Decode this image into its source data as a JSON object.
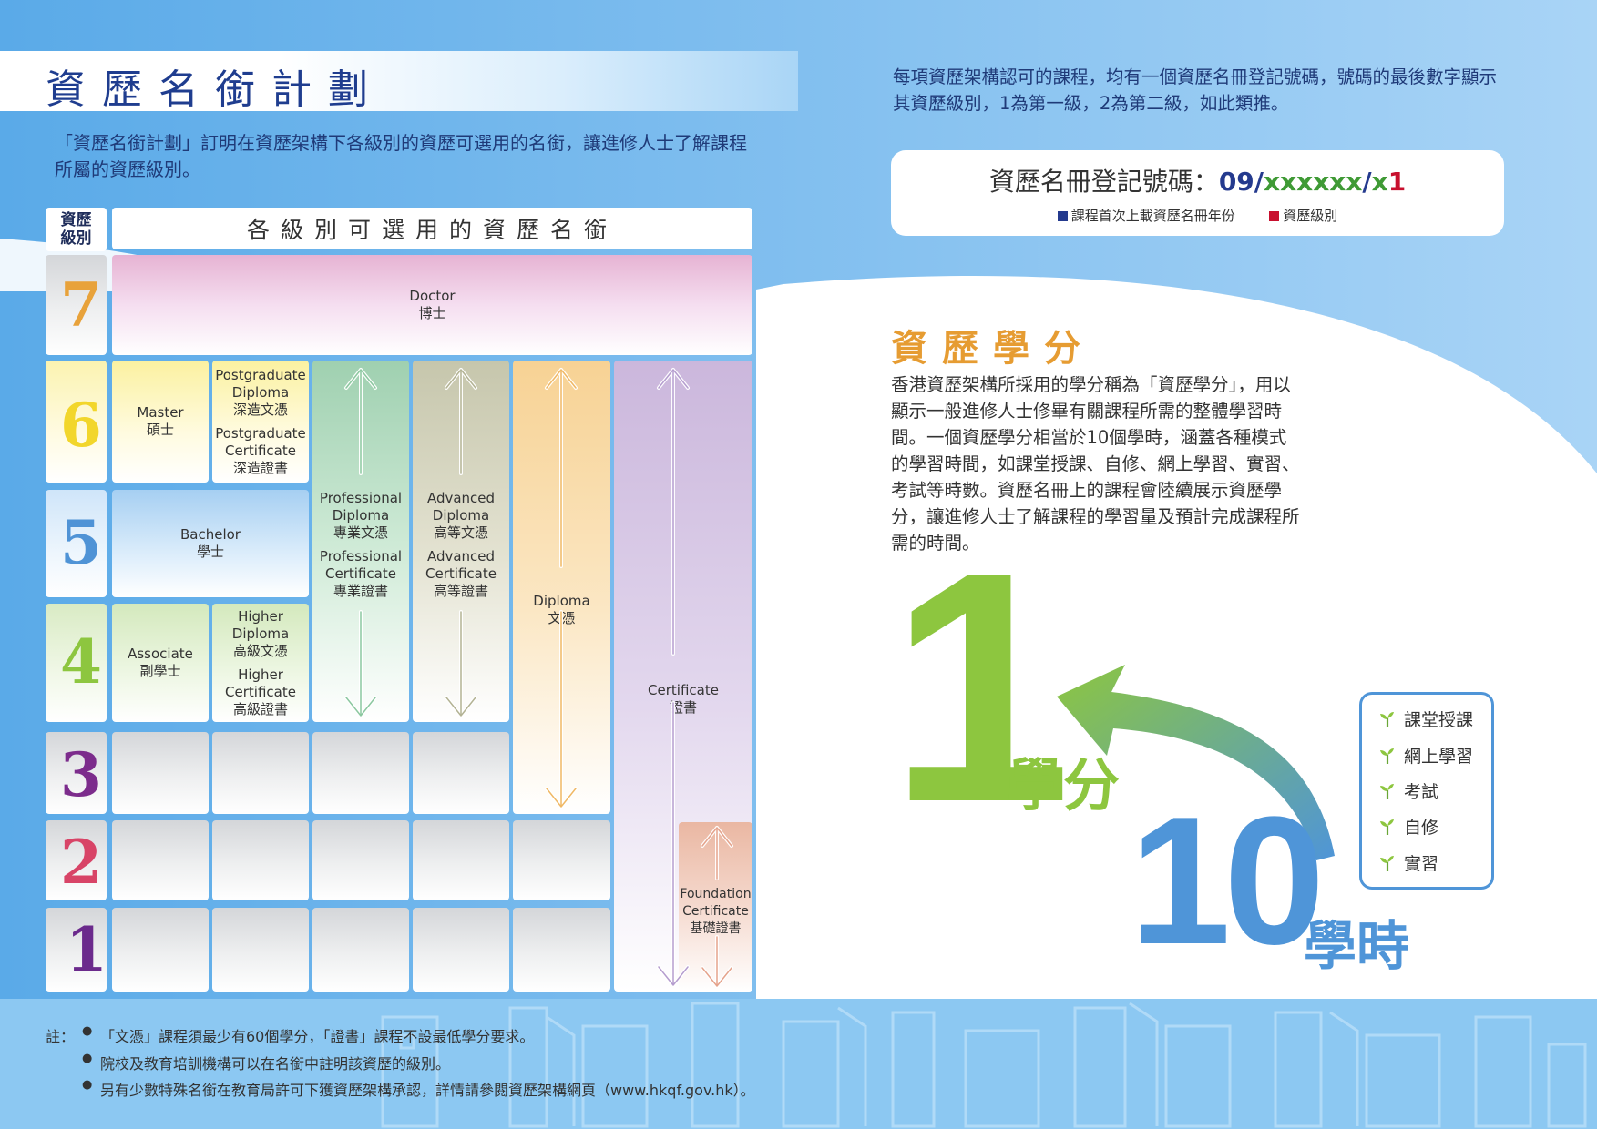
{
  "header": {
    "title": "資歷名銜計劃",
    "intro": "「資歷名銜計劃」訂明在資歷架構下各級別的資歷可選用的名銜，讓進修人士了解課程所屬的資歷級別。"
  },
  "table": {
    "level_header": "資歷級別",
    "titles_header": "各級別可選用的資歷名銜",
    "levels": [
      "7",
      "6",
      "5",
      "4",
      "3",
      "2",
      "1"
    ],
    "level_colors": [
      "#e8a23a",
      "#f2d62b",
      "#4f93d6",
      "#8dc63f",
      "#7c2c8c",
      "#d84467",
      "#6b2a8c"
    ],
    "cells": {
      "doctor": [
        "Doctor",
        "博士"
      ],
      "master": [
        "Master",
        "碩士"
      ],
      "pg_diploma": [
        "Postgraduate",
        "Diploma",
        "深造文憑"
      ],
      "pg_certificate": [
        "Postgraduate",
        "Certificate",
        "深造證書"
      ],
      "bachelor": [
        "Bachelor",
        "學士"
      ],
      "associate": [
        "Associate",
        "副學士"
      ],
      "higher_diploma": [
        "Higher",
        "Diploma",
        "高級文憑"
      ],
      "higher_certificate": [
        "Higher",
        "Certificate",
        "高級證書"
      ],
      "prof_diploma": [
        "Professional",
        "Diploma",
        "專業文憑"
      ],
      "prof_certificate": [
        "Professional",
        "Certificate",
        "專業證書"
      ],
      "adv_diploma": [
        "Advanced",
        "Diploma",
        "高等文憑"
      ],
      "adv_certificate": [
        "Advanced",
        "Certificate",
        "高等證書"
      ],
      "diploma": [
        "Diploma",
        "文憑"
      ],
      "certificate": [
        "Certificate",
        "證書"
      ],
      "foundation_certificate": [
        "Foundation",
        "Certificate",
        "基礎證書"
      ]
    }
  },
  "registration": {
    "intro": "每項資歷架構認可的課程，均有一個資歷名冊登記號碼，號碼的最後數字顯示其資歷級別，1為第一級，2為第二級，如此類推。",
    "label": "資歷名冊登記號碼：",
    "code_year": "09",
    "code_sep1": "/",
    "code_mid": "xxxxxx",
    "code_sep2": "/",
    "code_x": "x",
    "code_level": "1",
    "legend_year": "課程首次上載資歷名冊年份",
    "legend_level": "資歷級別",
    "color_year": "#243a8e",
    "color_level": "#c8102e"
  },
  "credits": {
    "title": "資歷學分",
    "body": "香港資歷架構所採用的學分稱為「資歷學分」，用以顯示一般進修人士修畢有關課程所需的整體學習時間。一個資歷學分相當於10個學時，涵蓋各種模式的學習時間，如課堂授課、自修、網上學習、實習、考試等時數。資歷名冊上的課程會陸續展示資歷學分，讓進修人士了解課程的學習量及預計完成課程所需的時間。",
    "big_one": "1",
    "credit_word": "學分",
    "big_ten": "10",
    "hours_word": "學時",
    "modes": [
      "課堂授課",
      "網上學習",
      "考試",
      "自修",
      "實習"
    ]
  },
  "notes": {
    "label": "註：",
    "bullet": "●",
    "items": [
      "「文憑」課程須最少有60個學分，「證書」課程不設最低學分要求。",
      "院校及教育培訓機構可以在名銜中註明該資歷的級別。",
      "另有少數特殊名銜在教育局許可下獲資歷架構承認，詳情請參閱資歷架構網頁（www.hkqf.gov.hk）。"
    ]
  }
}
